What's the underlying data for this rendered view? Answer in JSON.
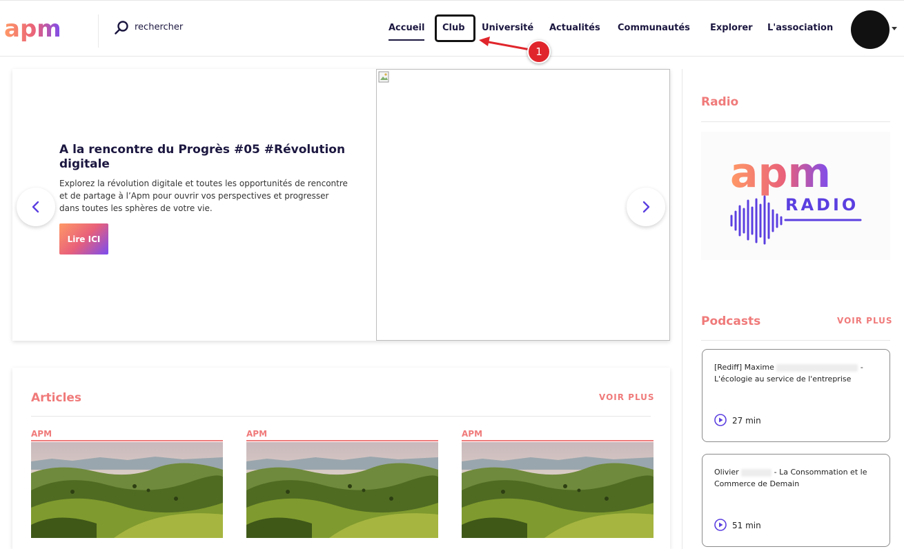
{
  "header": {
    "logo_text": "apm",
    "search": {
      "placeholder": "rechercher"
    },
    "nav": [
      {
        "label": "Accueil",
        "active": true
      },
      {
        "label": "Club",
        "active": false
      },
      {
        "label": "Université",
        "active": false
      },
      {
        "label": "Actualités",
        "active": false
      },
      {
        "label": "Communautés",
        "active": false
      },
      {
        "label": "Explorer",
        "active": false
      },
      {
        "label": "L'association",
        "active": false
      }
    ]
  },
  "annotation": {
    "step_number": "1",
    "color": "#e0262c"
  },
  "hero": {
    "title": "A la rencontre du Progrès #05 #Révolution digitale",
    "description": "Explorez la révolution digitale et toutes les opportunités de rencontre et de partage à l’Apm pour ouvrir vos perspectives et progresser dans toutes les sphères de votre vie.",
    "cta_label": "Lire ICI"
  },
  "articles": {
    "title": "Articles",
    "see_more": "VOIR PLUS",
    "items": [
      {
        "tag": "APM"
      },
      {
        "tag": "APM"
      },
      {
        "tag": "APM"
      }
    ]
  },
  "radio": {
    "title": "Radio",
    "logo_text": "apm",
    "logo_subtext": "RADIO"
  },
  "podcasts": {
    "title": "Podcasts",
    "see_more": "VOIR PLUS",
    "items": [
      {
        "title_prefix": "[Rediff] Maxime",
        "title_suffix": "- L'écologie au service de l'entreprise",
        "duration": "27 min"
      },
      {
        "title_prefix": "Olivier",
        "title_suffix": "- La Consommation et le Commerce de Demain",
        "duration": "51 min"
      }
    ]
  },
  "colors": {
    "brand_navy": "#1b1740",
    "accent_coral": "#f07a7a",
    "gradient_start": "#ff9966",
    "gradient_end": "#7a4cf0",
    "radio_purple": "#5b3fe0"
  }
}
